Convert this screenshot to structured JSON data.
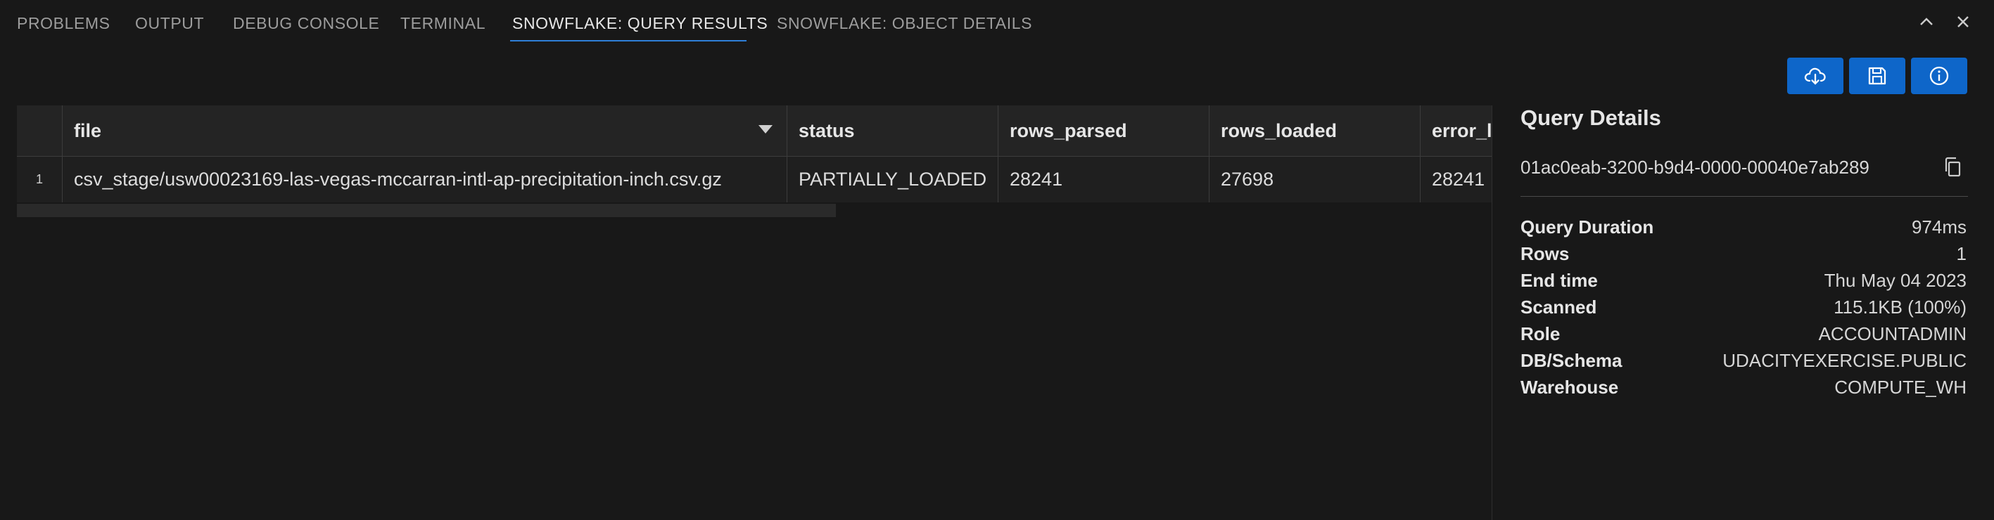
{
  "tabs": [
    "PROBLEMS",
    "OUTPUT",
    "DEBUG CONSOLE",
    "TERMINAL",
    "SNOWFLAKE: QUERY RESULTS",
    "SNOWFLAKE: OBJECT DETAILS"
  ],
  "active_tab": "SNOWFLAKE: QUERY RESULTS",
  "window_controls": [
    "chevron-up-icon",
    "close-icon"
  ],
  "toolbar": [
    "cloud-download-icon",
    "save-icon",
    "info-icon"
  ],
  "colors": {
    "accent": "#2f7fd8",
    "button": "#0e66c9",
    "background": "#181818"
  },
  "results": {
    "columns": [
      "file",
      "status",
      "rows_parsed",
      "rows_loaded",
      "error_lim"
    ],
    "rows": [
      {
        "row_number": "1",
        "file": "csv_stage/usw00023169-las-vegas-mccarran-intl-ap-precipitation-inch.csv.gz",
        "status": "PARTIALLY_LOADED",
        "rows_parsed": "28241",
        "rows_loaded": "27698",
        "error_lim": "28241"
      }
    ]
  },
  "details": {
    "title": "Query Details",
    "query_id": "01ac0eab-3200-b9d4-0000-00040e7ab289",
    "items": [
      {
        "label": "Query Duration",
        "value": "974ms"
      },
      {
        "label": "Rows",
        "value": "1"
      },
      {
        "label": "End time",
        "value": "Thu May 04 2023"
      },
      {
        "label": "Scanned",
        "value": "115.1KB (100%)"
      },
      {
        "label": "Role",
        "value": "ACCOUNTADMIN"
      },
      {
        "label": "DB/Schema",
        "value": "UDACITYEXERCISE.PUBLIC"
      },
      {
        "label": "Warehouse",
        "value": "COMPUTE_WH"
      }
    ]
  }
}
